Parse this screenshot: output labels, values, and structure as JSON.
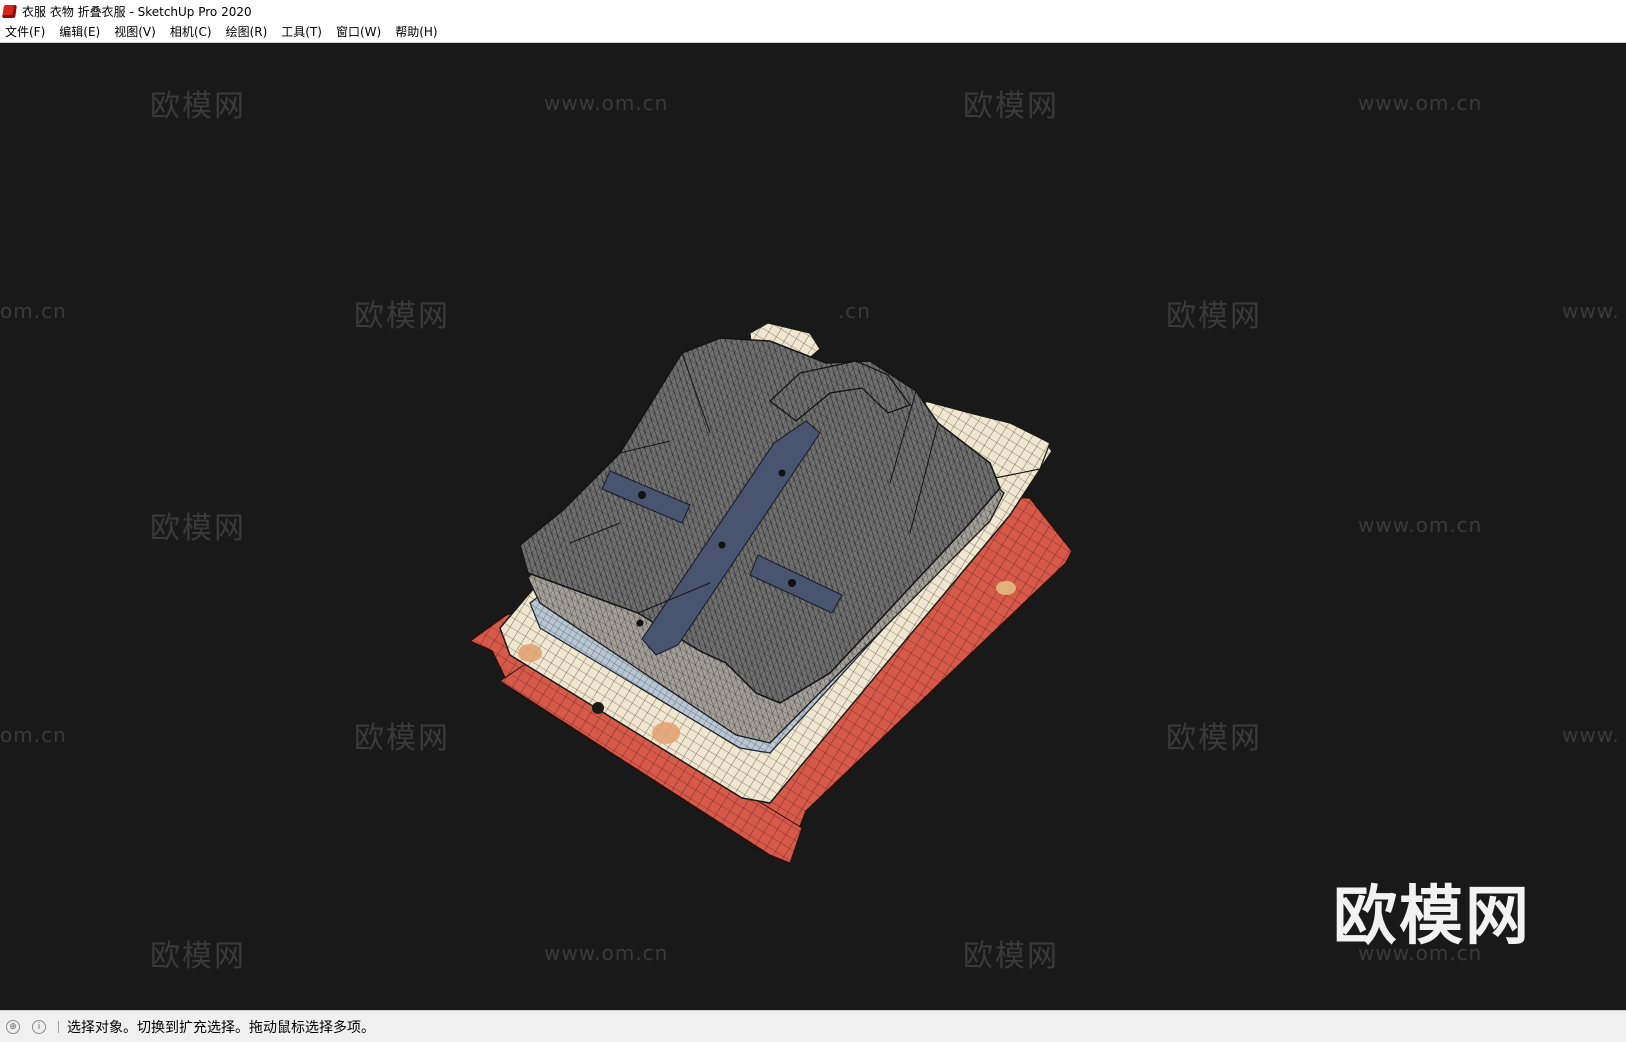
{
  "window": {
    "title": "衣服 衣物 折叠衣服 - SketchUp Pro 2020",
    "logo_icon": "sketchup-logo-icon"
  },
  "menu": {
    "items": [
      {
        "label": "文件(F)"
      },
      {
        "label": "编辑(E)"
      },
      {
        "label": "视图(V)"
      },
      {
        "label": "相机(C)"
      },
      {
        "label": "绘图(R)"
      },
      {
        "label": "工具(T)"
      },
      {
        "label": "窗口(W)"
      },
      {
        "label": "帮助(H)"
      }
    ]
  },
  "viewport": {
    "background": "#191919",
    "watermark_text": "欧模网",
    "watermark_url": "www.om.cn",
    "watermark_url_partial_left": "om.cn",
    "watermark_url_partial_right": "www.",
    "watermark_url_partial_center": ".cn",
    "brand_watermark": "欧模网"
  },
  "colors": {
    "jacket": "#6c6c6c",
    "cream": "#f1e7d0",
    "red": "#d7594a",
    "navy": "#495470",
    "light_blue": "#a8b8c8"
  },
  "status": {
    "icons": [
      "geo-location-icon",
      "info-icon"
    ],
    "text": "选择对象。切换到扩充选择。拖动鼠标选择多项。"
  }
}
